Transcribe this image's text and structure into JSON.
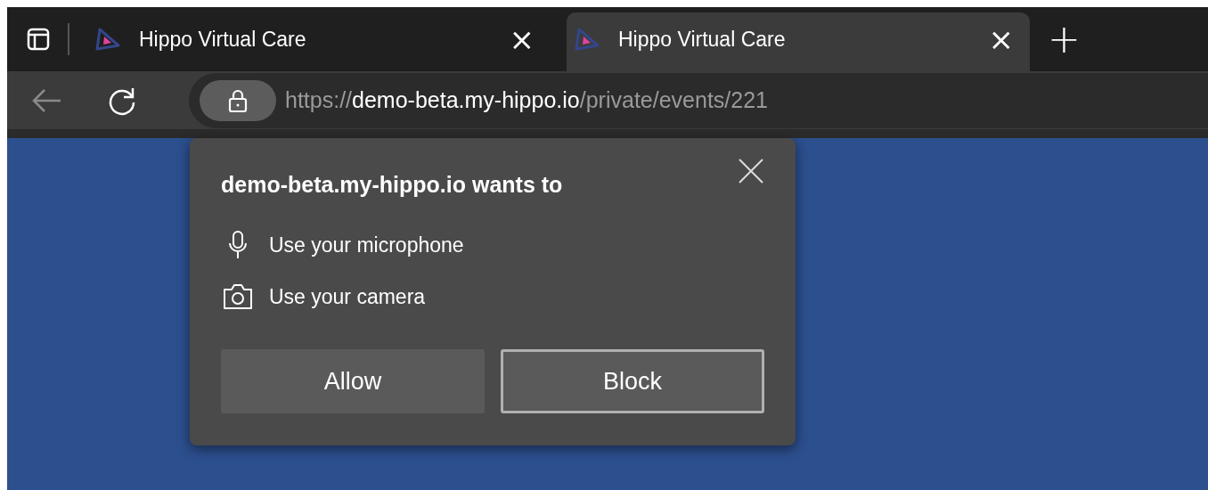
{
  "tabs": [
    {
      "title": "Hippo Virtual Care",
      "close": "×",
      "selected": false
    },
    {
      "title": "Hippo Virtual Care",
      "close": "×",
      "selected": true
    }
  ],
  "new_tab": "+",
  "address_bar": {
    "scheme": "https://",
    "host": "demo-beta.my-hippo.io",
    "path": "/private/events/221"
  },
  "permission_dialog": {
    "title": "demo-beta.my-hippo.io wants to",
    "permissions": [
      {
        "kind": "microphone",
        "label": "Use your microphone"
      },
      {
        "kind": "camera",
        "label": "Use your camera"
      }
    ],
    "buttons": [
      {
        "label": "Allow",
        "focused": false
      },
      {
        "label": "Block",
        "focused": true
      }
    ]
  }
}
